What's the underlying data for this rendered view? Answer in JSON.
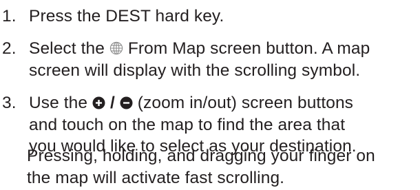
{
  "steps": [
    {
      "number": "1.",
      "lines": [
        "Press the DEST hard key."
      ]
    },
    {
      "number": "2.",
      "line1_before": "Select the",
      "line1_icon": "globe-icon",
      "line1_after": "From Map screen button. A map",
      "line2": "screen will display with the scrolling symbol."
    },
    {
      "number": "3.",
      "line1_before": "Use the",
      "line1_icon_in": "zoom-in-icon",
      "line1_sep": "/",
      "line1_icon_out": "zoom-out-icon",
      "line1_after": "(zoom in/out) screen buttons",
      "line2": "and touch on the map to find the area that",
      "line3": "you would like to select as your destination."
    }
  ],
  "note": {
    "line1": "Pressing, holding, and dragging your finger on",
    "line2": "the map will activate fast scrolling."
  },
  "colors": {
    "text": "#231f20",
    "icon_stroke": "#8a8a8a"
  }
}
